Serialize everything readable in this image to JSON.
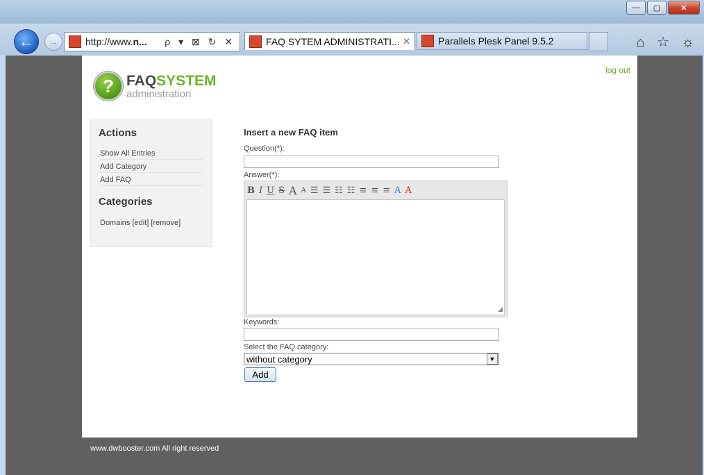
{
  "browser": {
    "address_prefix": "http://www.",
    "address_bold": "n...",
    "address_tools": "ρ ▾ ⊠ ↻ ✕",
    "tabs": [
      {
        "title": "FAQ SYTEM ADMINISTRATI...",
        "close": "✕"
      },
      {
        "title": "Parallels Plesk Panel 9.5.2"
      }
    ],
    "right_icons": "⌂ ☆ ☼"
  },
  "page": {
    "logo_faq": "FAQ",
    "logo_system": "SYSTEM",
    "logo_sub": "administration",
    "logout": "log out",
    "sidebar": {
      "actions_title": "Actions",
      "links": [
        "Show All Entries",
        "Add Category",
        "Add FAQ"
      ],
      "categories_title": "Categories",
      "category": "Domains [edit] [remove]"
    },
    "form": {
      "title": "Insert a new FAQ item",
      "question_label": "Question(*):",
      "answer_label": "Answer(*):",
      "keywords_label": "Keywords:",
      "category_label": "Select the FAQ category:",
      "category_value": "without category",
      "add_button": "Add"
    },
    "editor_toolbar": [
      "B",
      "I",
      "U",
      "S",
      "A",
      "A",
      "☰",
      "☰",
      "☷",
      "☷",
      "≡",
      "≡",
      "≡",
      "A",
      "A"
    ],
    "footer": "www.dwbooster.com All right reserved"
  }
}
